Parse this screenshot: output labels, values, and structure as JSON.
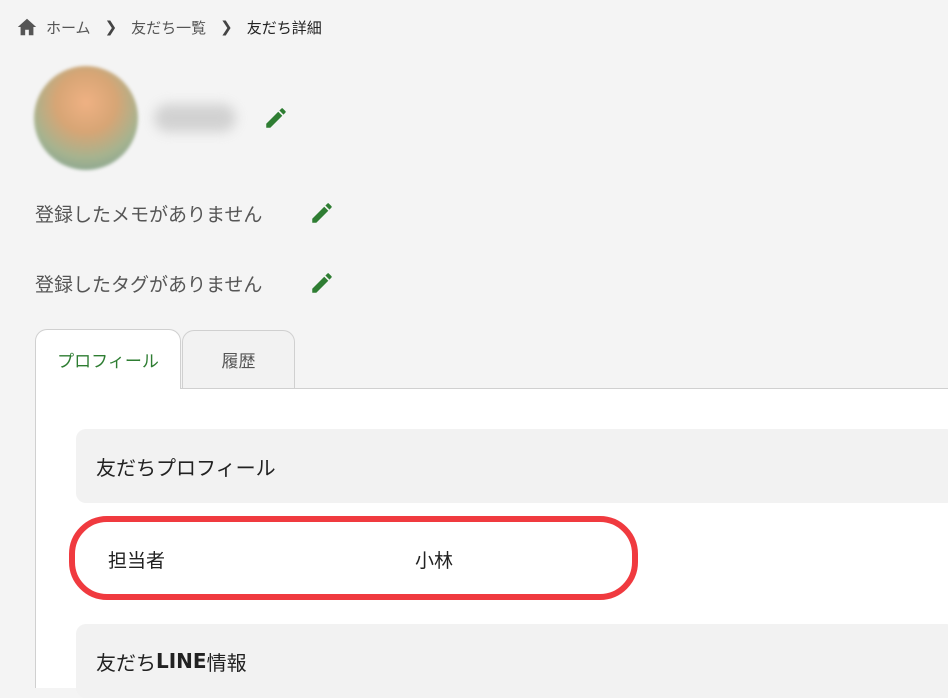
{
  "breadcrumb": {
    "home_icon": "home-icon",
    "items": [
      "ホーム",
      "友だち一覧",
      "友だち詳細"
    ],
    "separator_icon": "chevron-right-icon"
  },
  "profile": {
    "edit_icon": "pencil-icon",
    "memo_empty": "登録したメモがありません",
    "tag_empty": "登録したタグがありません"
  },
  "tabs": [
    {
      "label": "プロフィール",
      "active": true
    },
    {
      "label": "履歴",
      "active": false
    }
  ],
  "sections": {
    "profile_title": "友だちプロフィール",
    "assignee_label": "担当者",
    "assignee_value": "小林",
    "line_info_prefix": "友だち",
    "line_info_bold": "LINE",
    "line_info_suffix": "情報"
  },
  "colors": {
    "accent": "#2e7d32",
    "highlight": "#f03a3f",
    "background": "#f4f4f4"
  }
}
